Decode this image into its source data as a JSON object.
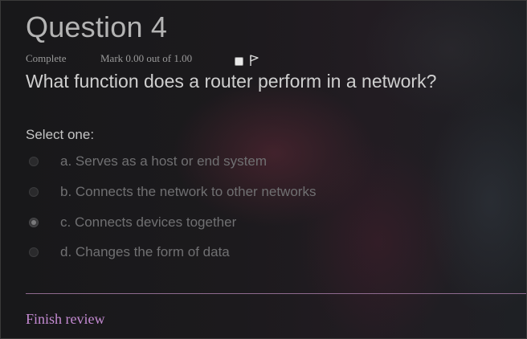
{
  "question": {
    "title": "Question 4",
    "state": "Complete",
    "mark": "Mark 0.00 out of 1.00",
    "text": "What function does a router perform in a network?",
    "prompt": "Select one:",
    "flag_icon": "flag-icon",
    "answers": [
      {
        "label": "a. Serves as a host or end system",
        "selected": false
      },
      {
        "label": "b. Connects the network to other networks",
        "selected": false
      },
      {
        "label": "c. Connects devices together",
        "selected": true
      },
      {
        "label": "d. Changes the form of data",
        "selected": false
      }
    ]
  },
  "footer": {
    "finish_label": "Finish review"
  },
  "colors": {
    "accent_link": "#c48ad2",
    "divider": "#8e6a8e"
  }
}
